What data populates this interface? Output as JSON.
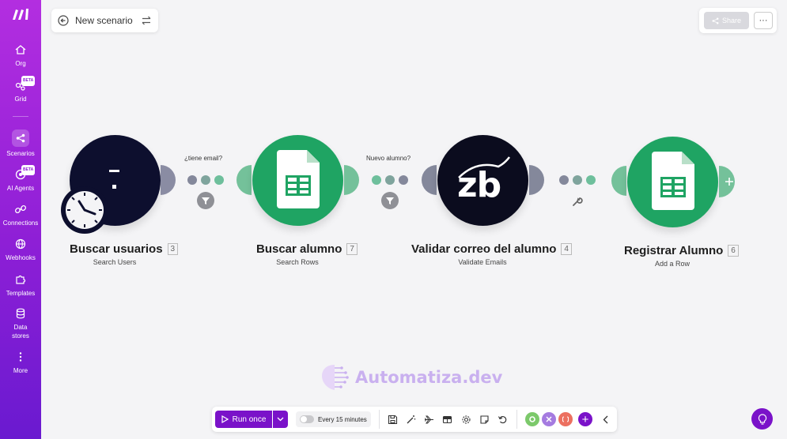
{
  "sidebar": {
    "logo": "make-logo",
    "items": [
      {
        "label": "Org",
        "icon": "home-icon"
      },
      {
        "label": "Grid",
        "icon": "grid-icon",
        "badge": "BETA"
      },
      {
        "label": "Scenarios",
        "icon": "share-nodes-icon",
        "active": true
      },
      {
        "label": "AI Agents",
        "icon": "ai-agent-icon",
        "badge": "BETA"
      },
      {
        "label": "Connections",
        "icon": "link-icon"
      },
      {
        "label": "Webhooks",
        "icon": "globe-icon"
      },
      {
        "label": "Templates",
        "icon": "puzzle-icon"
      },
      {
        "label": "Data stores",
        "icon": "database-icon"
      },
      {
        "label": "More",
        "icon": "more-vertical-icon"
      }
    ]
  },
  "header": {
    "title": "New scenario",
    "share_label": "Share",
    "more_label": "···"
  },
  "modules": [
    {
      "name": "Buscar usuarios",
      "number": "3",
      "subtitle": "Search Users"
    },
    {
      "name": "Buscar alumno",
      "number": "7",
      "subtitle": "Search Rows"
    },
    {
      "name": "Validar correo del alumno",
      "number": "4",
      "subtitle": "Validate Emails"
    },
    {
      "name": "Registrar Alumno",
      "number": "6",
      "subtitle": "Add a Row"
    }
  ],
  "routes": [
    {
      "label": "¿tiene email?"
    },
    {
      "label": "Nuevo alumno?"
    }
  ],
  "app_logo_text": "zb",
  "watermark": "Automatiza.dev",
  "toolbar": {
    "run_label": "Run once",
    "schedule_label": "Every 15 minutes"
  },
  "colors": {
    "brand": "#7a12c9",
    "sheets_green": "#1fa463",
    "module_dark": "#0d0f2e"
  }
}
